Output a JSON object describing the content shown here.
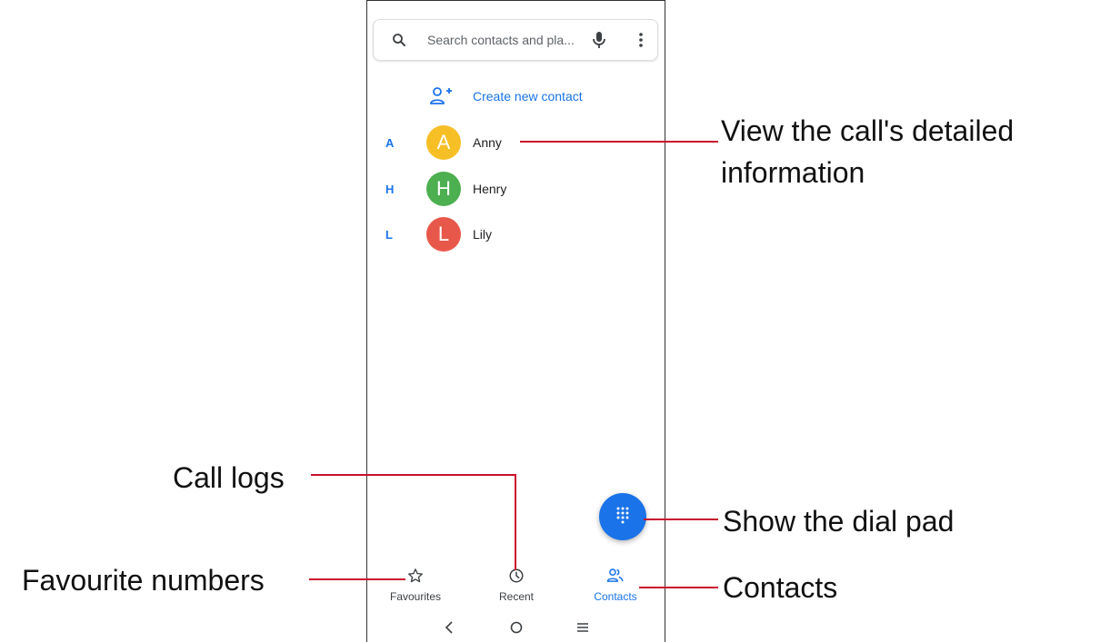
{
  "search": {
    "placeholder_text": "Search contacts and pla..."
  },
  "create_contact": {
    "label": "Create new contact"
  },
  "contacts": [
    {
      "section": "A",
      "initial": "A",
      "name": "Anny",
      "color": "#f6bf26"
    },
    {
      "section": "H",
      "initial": "H",
      "name": "Henry",
      "color": "#4caf50"
    },
    {
      "section": "L",
      "initial": "L",
      "name": "Lily",
      "color": "#e8584a"
    }
  ],
  "bottom_nav": [
    {
      "label": "Favourites",
      "icon": "star-icon",
      "active": false
    },
    {
      "label": "Recent",
      "icon": "clock-icon",
      "active": false
    },
    {
      "label": "Contacts",
      "icon": "contacts-icon",
      "active": true
    }
  ],
  "annotations": {
    "view_details_line1": "View the call's detailed",
    "view_details_line2": "information",
    "call_logs": "Call logs",
    "dial_pad": "Show the dial pad",
    "favourites": "Favourite numbers",
    "contacts": "Contacts"
  },
  "colors": {
    "accent": "#1a73e8",
    "leader": "#c8102e"
  }
}
